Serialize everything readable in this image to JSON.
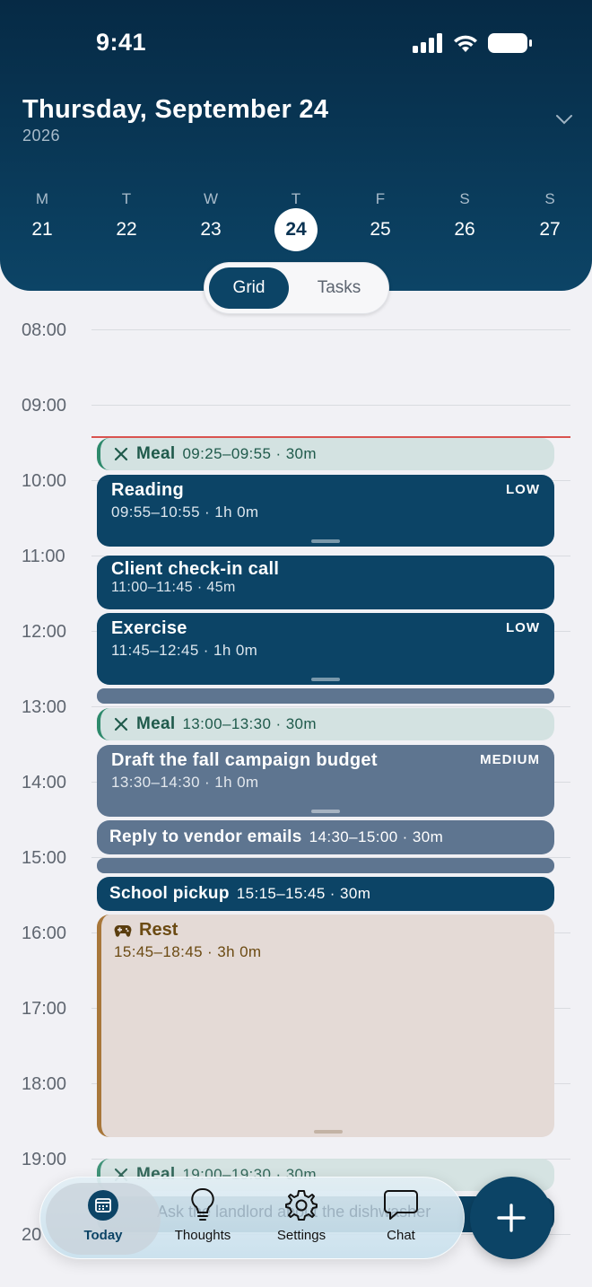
{
  "status": {
    "time": "9:41"
  },
  "header": {
    "date_title": "Thursday, September 24",
    "year": "2026",
    "week": [
      {
        "letter": "M",
        "num": "21"
      },
      {
        "letter": "T",
        "num": "22"
      },
      {
        "letter": "W",
        "num": "23"
      },
      {
        "letter": "T",
        "num": "24",
        "selected": true
      },
      {
        "letter": "F",
        "num": "25"
      },
      {
        "letter": "S",
        "num": "26"
      },
      {
        "letter": "S",
        "num": "27"
      }
    ]
  },
  "view_toggle": {
    "grid": "Grid",
    "tasks": "Tasks",
    "active": "Grid"
  },
  "hours": [
    "08:00",
    "09:00",
    "10:00",
    "11:00",
    "12:00",
    "13:00",
    "14:00",
    "15:00",
    "16:00",
    "17:00",
    "18:00",
    "19:00",
    "20"
  ],
  "events": {
    "meal1": {
      "title": "Meal",
      "time": "09:25–09:55 · 30m"
    },
    "reading": {
      "title": "Reading",
      "time": "09:55–10:55 · 1h 0m",
      "priority": "LOW"
    },
    "client": {
      "title": "Client check-in call",
      "time": "11:00–11:45 · 45m"
    },
    "exercise": {
      "title": "Exercise",
      "time": "11:45–12:45 · 1h 0m",
      "priority": "LOW"
    },
    "meal2": {
      "title": "Meal",
      "time": "13:00–13:30 · 30m"
    },
    "budget": {
      "title": "Draft the fall campaign budget",
      "time": "13:30–14:30 · 1h 0m",
      "priority": "MEDIUM"
    },
    "vendor": {
      "title": "Reply to vendor emails",
      "time": "14:30–15:00 · 30m"
    },
    "school": {
      "title": "School pickup",
      "time": "15:15–15:45 · 30m"
    },
    "rest": {
      "title": "Rest",
      "time": "15:45–18:45 · 3h 0m"
    },
    "meal3": {
      "title": "Meal",
      "time": "19:00–19:30 · 30m"
    }
  },
  "nav": {
    "ghost_text": "Ask the landlord about the dishwasher",
    "tabs": [
      {
        "label": "Today",
        "icon": "calendar-icon",
        "active": true
      },
      {
        "label": "Thoughts",
        "icon": "lightbulb-icon"
      },
      {
        "label": "Settings",
        "icon": "gear-icon"
      },
      {
        "label": "Chat",
        "icon": "chat-bubble-icon"
      }
    ]
  },
  "colors": {
    "primary": "#0c4466",
    "slate": "#5e7590",
    "meal": "#d3e2e1",
    "rest": "#e4dad6",
    "now_line": "#d9534f"
  }
}
